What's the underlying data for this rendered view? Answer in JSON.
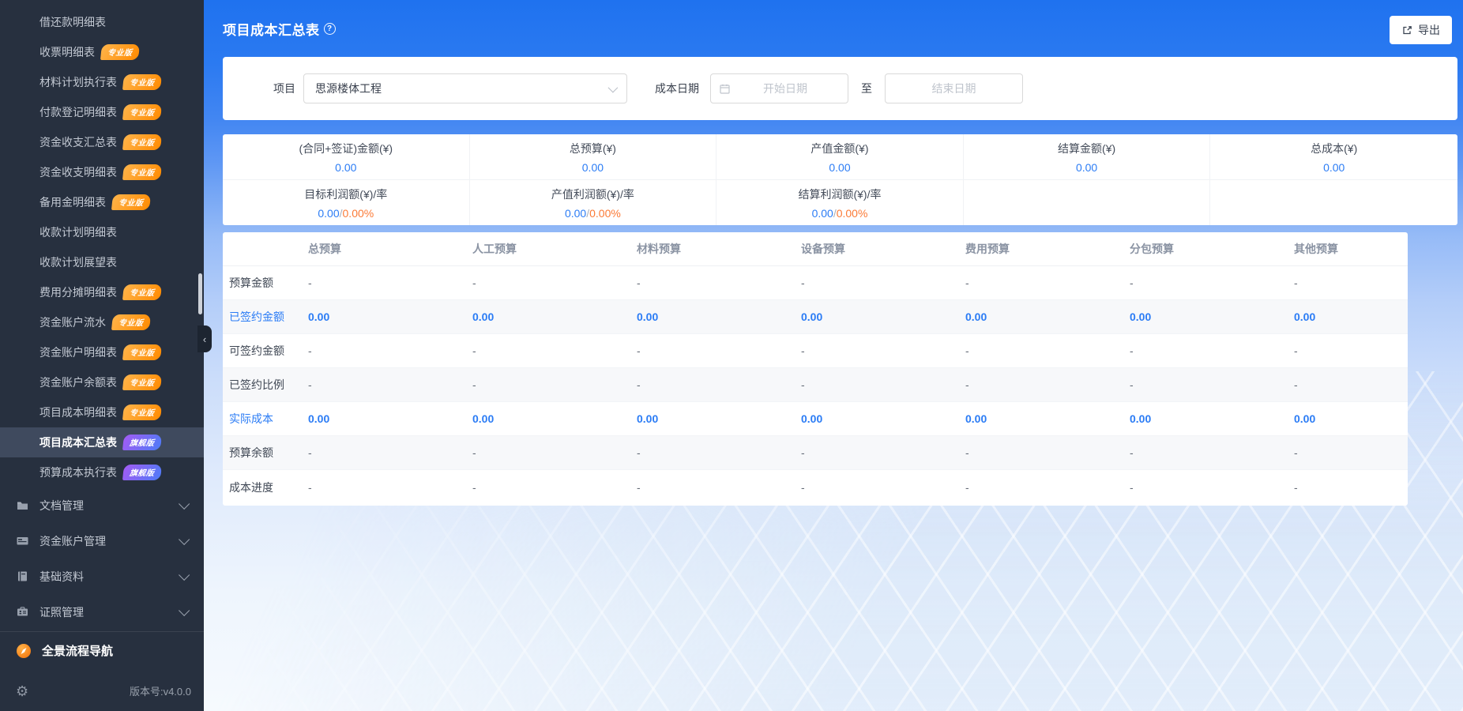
{
  "sidebar": {
    "badge_labels": {
      "pro": "专业版",
      "flagship": "旗舰版"
    },
    "items": [
      {
        "label": "借还款明细表",
        "badge": null,
        "selected": false
      },
      {
        "label": "收票明细表",
        "badge": "pro",
        "selected": false
      },
      {
        "label": "材料计划执行表",
        "badge": "pro",
        "selected": false
      },
      {
        "label": "付款登记明细表",
        "badge": "pro",
        "selected": false
      },
      {
        "label": "资金收支汇总表",
        "badge": "pro",
        "selected": false
      },
      {
        "label": "资金收支明细表",
        "badge": "pro",
        "selected": false
      },
      {
        "label": "备用金明细表",
        "badge": "pro",
        "selected": false
      },
      {
        "label": "收款计划明细表",
        "badge": null,
        "selected": false
      },
      {
        "label": "收款计划展望表",
        "badge": null,
        "selected": false
      },
      {
        "label": "费用分摊明细表",
        "badge": "pro",
        "selected": false
      },
      {
        "label": "资金账户流水",
        "badge": "pro",
        "selected": false
      },
      {
        "label": "资金账户明细表",
        "badge": "pro",
        "selected": false
      },
      {
        "label": "资金账户余额表",
        "badge": "pro",
        "selected": false
      },
      {
        "label": "项目成本明细表",
        "badge": "pro",
        "selected": false
      },
      {
        "label": "项目成本汇总表",
        "badge": "flagship",
        "selected": true
      },
      {
        "label": "预算成本执行表",
        "badge": "flagship",
        "selected": false
      }
    ],
    "groups": [
      {
        "label": "文档管理",
        "icon": "folder-icon"
      },
      {
        "label": "资金账户管理",
        "icon": "card-icon"
      },
      {
        "label": "基础资料",
        "icon": "book-icon"
      },
      {
        "label": "证照管理",
        "icon": "certificate-icon"
      }
    ],
    "footer": {
      "panorama": "全景流程导航",
      "version": "版本号:v4.0.0"
    }
  },
  "header": {
    "title": "项目成本汇总表",
    "export": "导出"
  },
  "filters": {
    "project_label": "项目",
    "project_value": "思源楼体工程",
    "date_label": "成本日期",
    "start_placeholder": "开始日期",
    "to": "至",
    "end_placeholder": "结束日期"
  },
  "stats": {
    "row1": [
      {
        "label": "(合同+签证)金额(¥)",
        "value": "0.00"
      },
      {
        "label": "总预算(¥)",
        "value": "0.00"
      },
      {
        "label": "产值金额(¥)",
        "value": "0.00"
      },
      {
        "label": "结算金额(¥)",
        "value": "0.00"
      },
      {
        "label": "总成本(¥)",
        "value": "0.00"
      }
    ],
    "row2": [
      {
        "label": "目标利润额(¥)/率",
        "amount": "0.00",
        "slash": "/",
        "rate": "0.00%"
      },
      {
        "label": "产值利润额(¥)/率",
        "amount": "0.00",
        "slash": "/",
        "rate": "0.00%"
      },
      {
        "label": "结算利润额(¥)/率",
        "amount": "0.00",
        "slash": "/",
        "rate": "0.00%"
      },
      null,
      null
    ]
  },
  "table": {
    "columns": [
      "",
      "总预算",
      "人工预算",
      "材料预算",
      "设备预算",
      "费用预算",
      "分包预算",
      "其他预算"
    ],
    "rows": [
      {
        "label": "预算金额",
        "link": false,
        "values": [
          "-",
          "-",
          "-",
          "-",
          "-",
          "-",
          "-"
        ]
      },
      {
        "label": "已签约金额",
        "link": true,
        "values": [
          "0.00",
          "0.00",
          "0.00",
          "0.00",
          "0.00",
          "0.00",
          "0.00"
        ]
      },
      {
        "label": "可签约金额",
        "link": false,
        "values": [
          "-",
          "-",
          "-",
          "-",
          "-",
          "-",
          "-"
        ]
      },
      {
        "label": "已签约比例",
        "link": false,
        "values": [
          "-",
          "-",
          "-",
          "-",
          "-",
          "-",
          "-"
        ]
      },
      {
        "label": "实际成本",
        "link": true,
        "values": [
          "0.00",
          "0.00",
          "0.00",
          "0.00",
          "0.00",
          "0.00",
          "0.00"
        ]
      },
      {
        "label": "预算余额",
        "link": false,
        "values": [
          "-",
          "-",
          "-",
          "-",
          "-",
          "-",
          "-"
        ]
      },
      {
        "label": "成本进度",
        "link": false,
        "values": [
          "-",
          "-",
          "-",
          "-",
          "-",
          "-",
          "-"
        ]
      }
    ]
  },
  "colors": {
    "accent_blue": "#2b7cf5",
    "accent_orange": "#fb7a36",
    "sidebar_bg": "#27303f",
    "badge_pro": "#ff8a00",
    "badge_flagship": "#4d7bf7"
  }
}
